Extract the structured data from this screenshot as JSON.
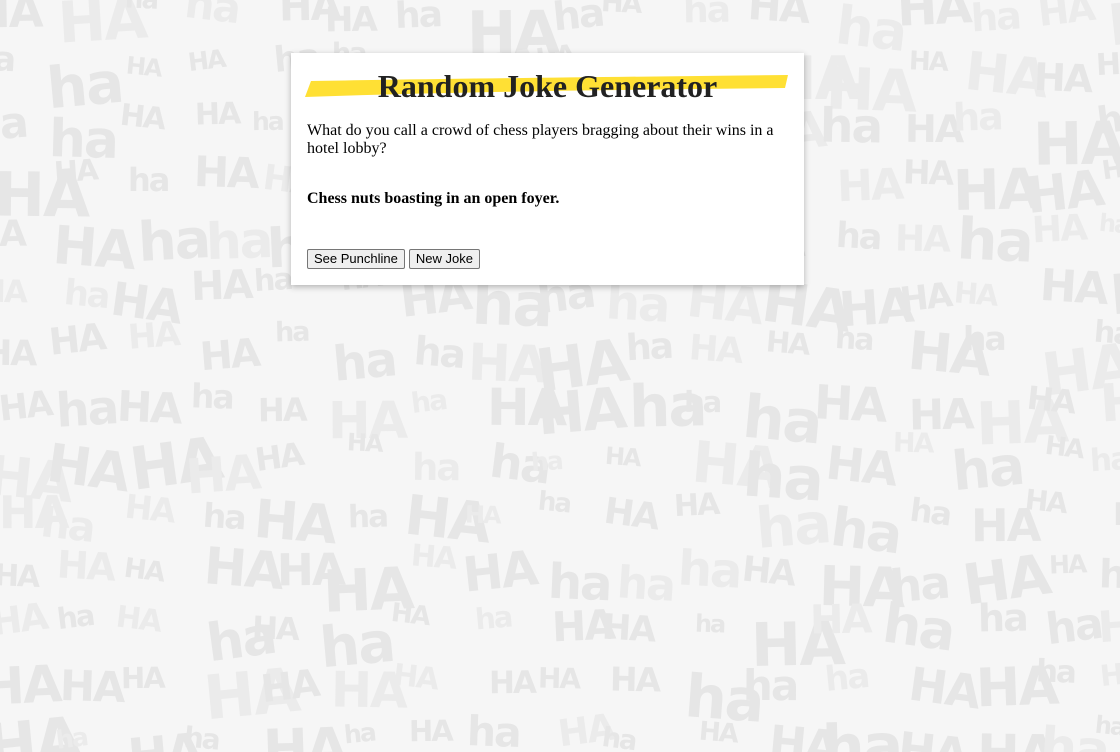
{
  "app": {
    "title": "Random Joke Generator"
  },
  "background": {
    "pattern_words": [
      "HA",
      "ha",
      "HA",
      "ha",
      "HA",
      "ha"
    ]
  },
  "joke": {
    "setup": "What do you call a crowd of chess players bragging about their wins in a hotel lobby?",
    "punchline": "Chess nuts boasting in an open foyer."
  },
  "actions": {
    "see_punchline_label": "See Punchline",
    "new_joke_label": "New Joke"
  },
  "colors": {
    "highlight": "#ffe034",
    "pattern": "#e6e6e6",
    "background": "#f6f6f6"
  }
}
